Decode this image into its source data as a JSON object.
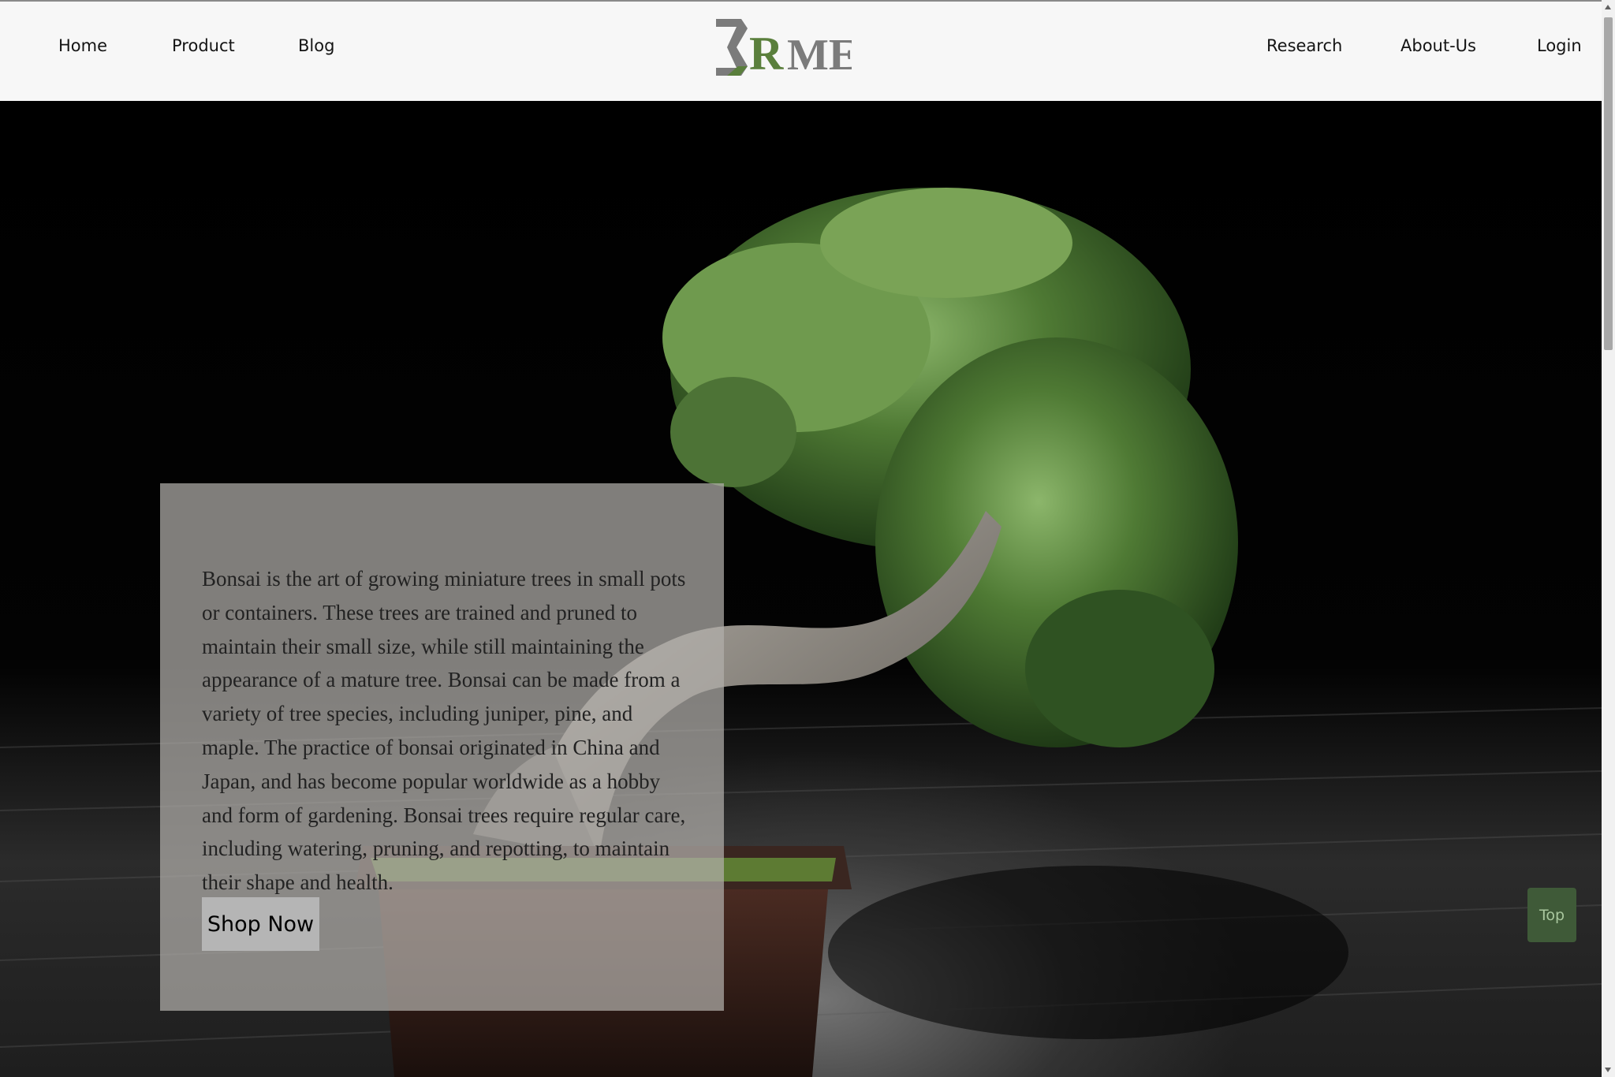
{
  "nav": {
    "left": [
      {
        "label": "Home"
      },
      {
        "label": "Product"
      },
      {
        "label": "Blog"
      }
    ],
    "right": [
      {
        "label": "Research"
      },
      {
        "label": "About-Us"
      },
      {
        "label": "Login"
      }
    ]
  },
  "logo": {
    "letter": "R",
    "text": "ME",
    "icon": "sigma-icon",
    "accent_color": "#5a7f3c",
    "gray_color": "#7b7b7b"
  },
  "hero": {
    "description": "Bonsai is the art of growing miniature trees in small pots or containers. These trees are trained and pruned to maintain their small size, while still maintaining the appearance of a mature tree. Bonsai can be made from a variety of tree species, including juniper, pine, and maple. The practice of bonsai originated in China and Japan, and has become popular worldwide as a hobby and form of gardening. Bonsai trees require regular care, including watering, pruning, and repotting, to maintain their shape and health.",
    "cta_label": "Shop Now"
  },
  "back_to_top": {
    "label": "Top"
  }
}
